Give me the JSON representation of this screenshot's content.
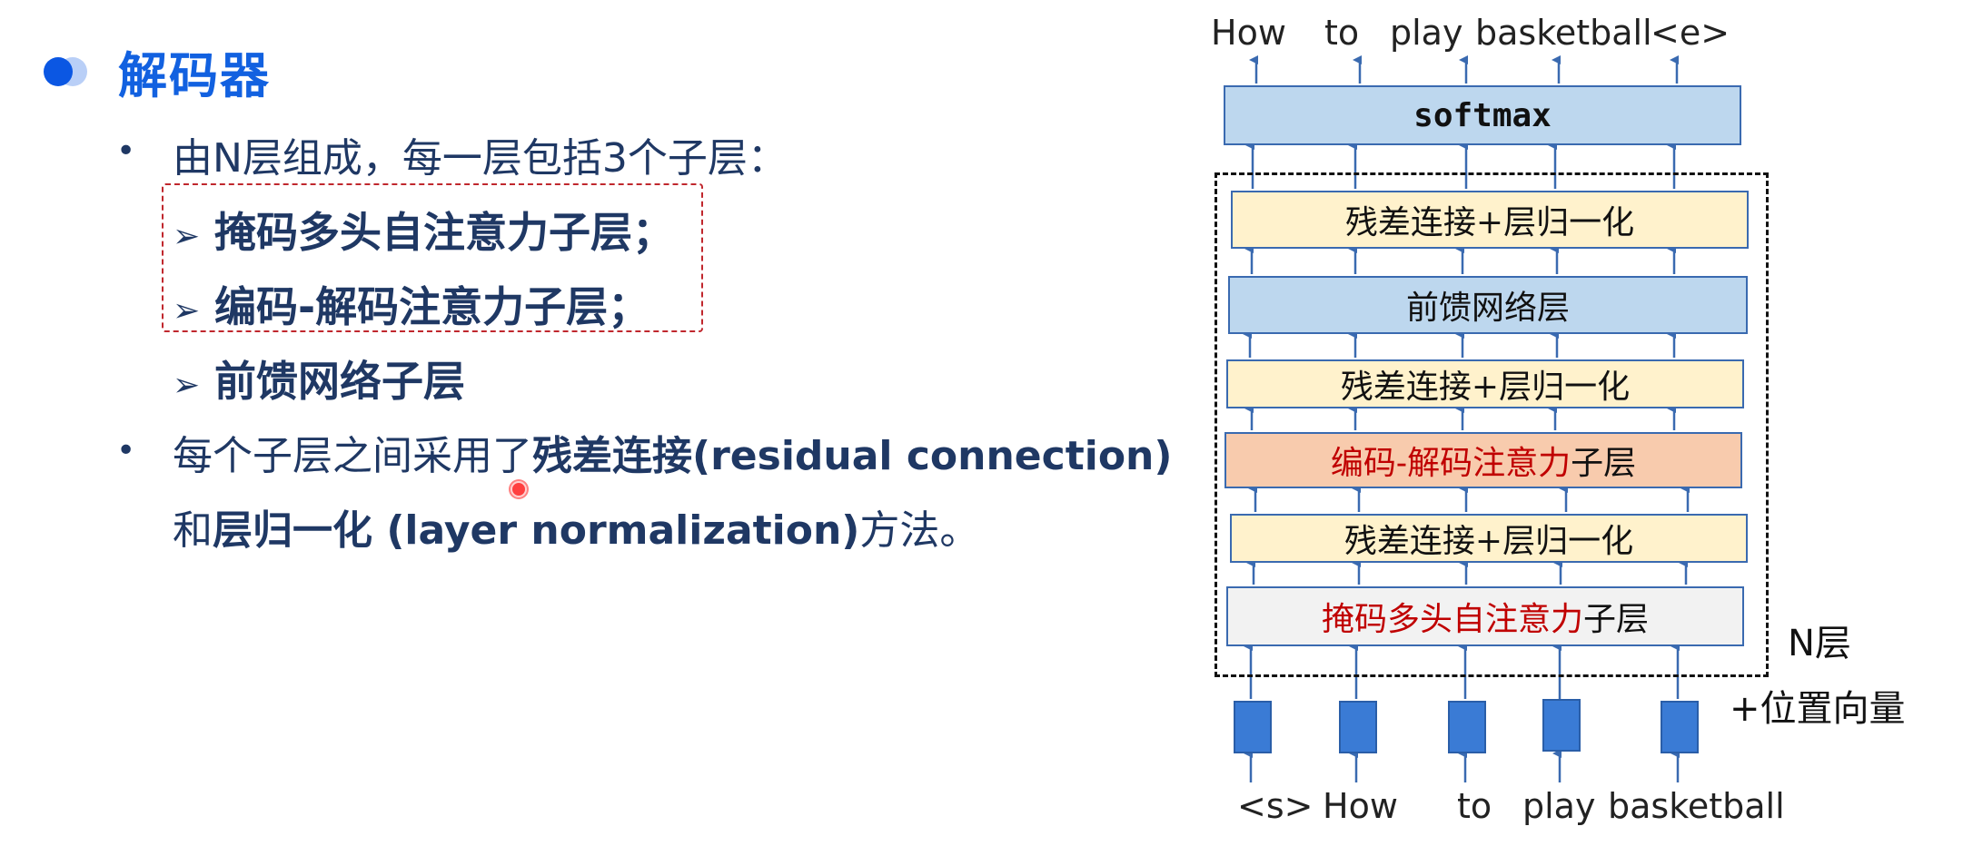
{
  "title": "解码器",
  "bullet1": "由N层组成，每一层包括3个子层：",
  "sublayers": [
    "掩码多头自注意力子层；",
    "编码-解码注意力子层；",
    "前馈网络子层"
  ],
  "bullet2": {
    "text1": "每个子层之间采用了",
    "bold1": "残差连接(residual connection)",
    "text2": "和",
    "bold2": "层归一化 (layer normalization)",
    "text3": "方法。"
  },
  "diagram": {
    "output_tokens": [
      "How",
      "to",
      "play",
      "basketball",
      "<e>"
    ],
    "input_tokens": [
      "<s>",
      "How",
      "to",
      "play",
      "basketball"
    ],
    "layers": {
      "softmax": "softmax",
      "addnorm": "残差连接+层归一化",
      "ffn": "前馈网络层",
      "encdec_red": "编码-解码注意力",
      "masked_red": "掩码多头自注意力",
      "sublayer_suffix": "子层"
    },
    "n_label": "N层",
    "pos_label": "+位置向量"
  },
  "colors": {
    "title": "#1261e0",
    "body_text": "#1f3864",
    "dashed_box": "#c0272d",
    "blue_layer": "#bdd7ee",
    "yellow_layer": "#fff2cc",
    "orange_layer": "#f8cbad",
    "gray_layer": "#f2f2f2",
    "arrow": "#3a6ab0",
    "embedding": "#3a7bd5"
  }
}
